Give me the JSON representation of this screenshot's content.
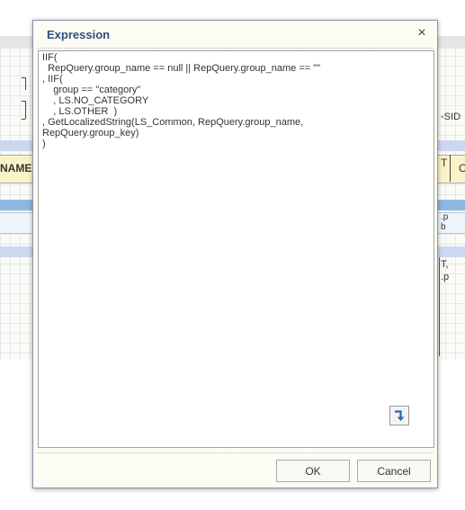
{
  "dialog": {
    "title": "Expression",
    "close_symbol": "×",
    "expression_lines": [
      "IIF(",
      "  RepQuery.group_name == null || RepQuery.group_name == \"\"",
      ", IIF(",
      "    group == \"category\"",
      "    , LS.NO_CATEGORY",
      "    , LS.OTHER  )",
      ", GetLocalizedString(LS_Common, RepQuery.group_name,",
      "RepQuery.group_key)",
      ")"
    ],
    "wrap_icon": "return-arrow-icon",
    "ok_label": "OK",
    "cancel_label": "Cancel"
  },
  "background": {
    "name_header": "NAME",
    "sid_label": "SID",
    "col_t": "T",
    "col_c": "C",
    "cell_p": ".p",
    "cell_b": "b",
    "cell_t": "T,",
    "cell_p2": ".p"
  },
  "colors": {
    "title": "#2c4f80",
    "band_blue": "#8db7e0",
    "band_light": "#cdd7f0",
    "header_yellow": "#fbf3c8"
  }
}
